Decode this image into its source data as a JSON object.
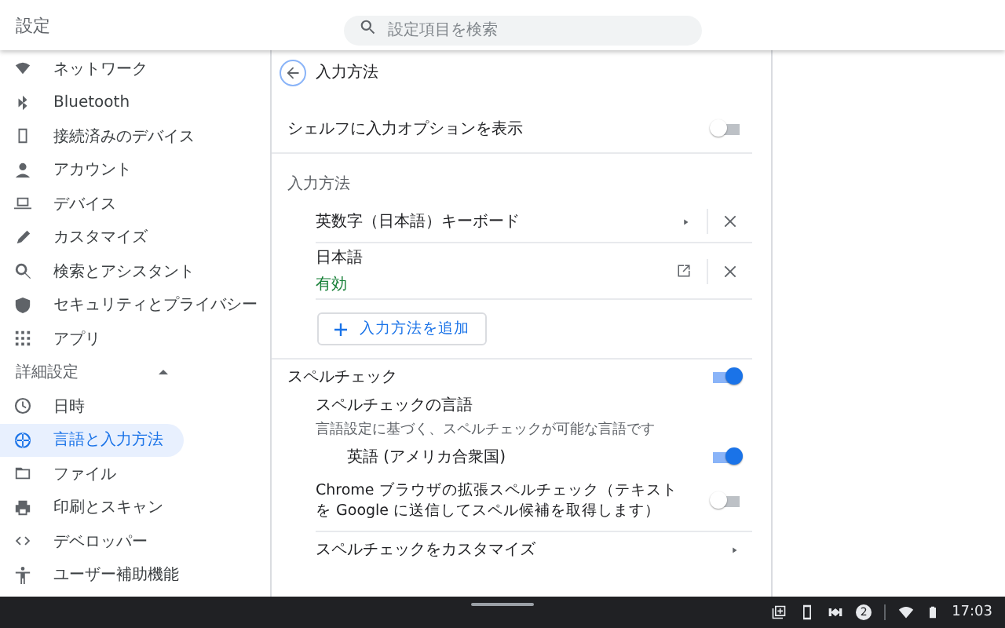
{
  "header": {
    "title": "設定",
    "search": {
      "placeholder": "設定項目を検索"
    }
  },
  "sidebar": {
    "items": [
      {
        "label": "ネットワーク",
        "selected": false
      },
      {
        "label": "Bluetooth",
        "selected": false
      },
      {
        "label": "接続済みのデバイス",
        "selected": false
      },
      {
        "label": "アカウント",
        "selected": false
      },
      {
        "label": "デバイス",
        "selected": false
      },
      {
        "label": "カスタマイズ",
        "selected": false
      },
      {
        "label": "検索とアシスタント",
        "selected": false
      },
      {
        "label": "セキュリティとプライバシー",
        "selected": false
      },
      {
        "label": "アプリ",
        "selected": false
      }
    ],
    "advanced": {
      "label": "詳細設定",
      "expanded": true,
      "items": [
        {
          "label": "日時",
          "selected": false
        },
        {
          "label": "言語と入力方法",
          "selected": true
        },
        {
          "label": "ファイル",
          "selected": false
        },
        {
          "label": "印刷とスキャン",
          "selected": false
        },
        {
          "label": "デベロッパー",
          "selected": false
        },
        {
          "label": "ユーザー補助機能",
          "selected": false
        }
      ]
    }
  },
  "page": {
    "title": "入力方法",
    "shelf_option": {
      "label": "シェルフに入力オプションを表示",
      "on": false
    },
    "input_methods": {
      "heading": "入力方法",
      "items": [
        {
          "name": "英数字（日本語）キーボード",
          "kind": "arrow"
        },
        {
          "name": "日本語",
          "status": "有効",
          "kind": "external"
        }
      ],
      "add_button": "入力方法を追加"
    },
    "spellcheck": {
      "label": "スペルチェック",
      "on": true,
      "languages_title": "スペルチェックの言語",
      "languages_desc": "言語設定に基づく、スペルチェックが可能な言語です",
      "languages": [
        {
          "name": "英語 (アメリカ合衆国)",
          "on": true
        }
      ],
      "enhanced": {
        "label": "Chrome ブラウザの拡張スペルチェック（テキストを Google に送信してスペル候補を取得します）",
        "on": false
      },
      "customize": "スペルチェックをカスタマイズ"
    }
  },
  "shelf": {
    "notification_count": "2",
    "time": "17:03"
  }
}
